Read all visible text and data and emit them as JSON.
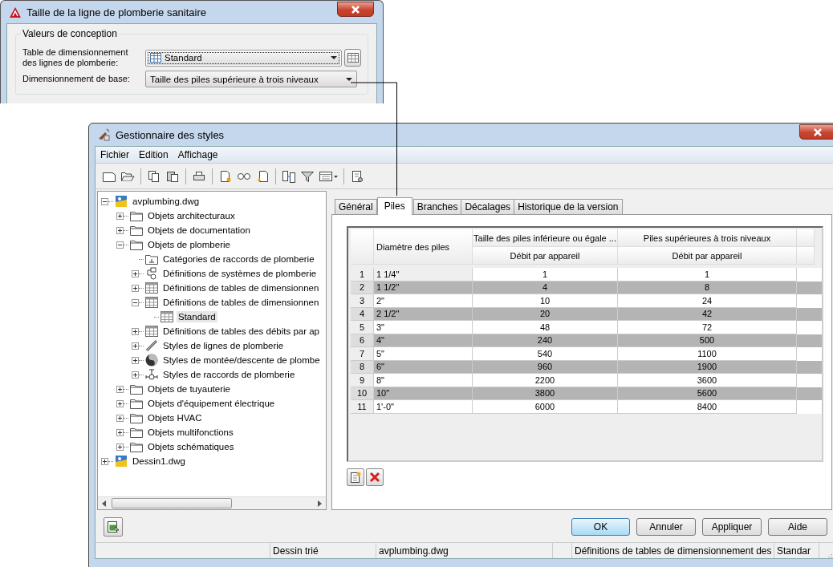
{
  "dialog": {
    "title": "Taille de la ligne de plomberie sanitaire",
    "group": "Valeurs de conception",
    "fields": [
      {
        "label": "Table de dimensionnement des lignes de plomberie:",
        "value": "Standard",
        "focused": true,
        "kind": "table"
      },
      {
        "label": "Dimensionnement de base:",
        "value": "Taille des piles supérieure à trois niveaux",
        "focused": false,
        "kind": "plain"
      }
    ]
  },
  "manager": {
    "title": "Gestionnaire des styles",
    "menu": [
      "Fichier",
      "Edition",
      "Affichage"
    ],
    "tree": [
      {
        "label": "avplumbing.dwg",
        "kind": "drawing",
        "expanded": true,
        "selected": false,
        "children": [
          {
            "label": "Objets architecturaux",
            "kind": "folder",
            "expanded": false,
            "selected": false
          },
          {
            "label": "Objets de documentation",
            "kind": "folder",
            "expanded": false,
            "selected": false
          },
          {
            "label": "Objets de plomberie",
            "kind": "folder",
            "expanded": true,
            "selected": false,
            "children": [
              {
                "label": "Catégories de raccords de plomberie",
                "kind": "category",
                "selected": false
              },
              {
                "label": "Définitions de systèmes de plomberie",
                "kind": "system",
                "expanded": false,
                "selected": false
              },
              {
                "label": "Définitions de tables de dimensionnen",
                "kind": "table",
                "expanded": false,
                "selected": false
              },
              {
                "label": "Définitions de tables de dimensionnen",
                "kind": "table",
                "expanded": true,
                "selected": false,
                "children": [
                  {
                    "label": "Standard",
                    "kind": "table",
                    "selected": true
                  }
                ]
              },
              {
                "label": "Définitions de tables des débits par ap",
                "kind": "table",
                "expanded": false,
                "selected": false
              },
              {
                "label": "Styles de lignes de plomberie",
                "kind": "line",
                "expanded": false,
                "selected": false
              },
              {
                "label": "Styles de montée/descente de plombe",
                "kind": "riser",
                "expanded": false,
                "selected": false
              },
              {
                "label": "Styles de raccords de plomberie",
                "kind": "fitting",
                "expanded": false,
                "selected": false
              }
            ]
          },
          {
            "label": "Objets de tuyauterie",
            "kind": "folder",
            "expanded": false,
            "selected": false
          },
          {
            "label": "Objets d'équipement électrique",
            "kind": "folder",
            "expanded": false,
            "selected": false
          },
          {
            "label": "Objets HVAC",
            "kind": "folder",
            "expanded": false,
            "selected": false
          },
          {
            "label": "Objets multifonctions",
            "kind": "folder",
            "expanded": false,
            "selected": false
          },
          {
            "label": "Objets schématiques",
            "kind": "folder",
            "expanded": false,
            "selected": false
          }
        ]
      },
      {
        "label": "Dessin1.dwg",
        "kind": "drawing",
        "expanded": false,
        "selected": false
      }
    ],
    "tabs": [
      {
        "label": "Général",
        "selected": false
      },
      {
        "label": "Piles",
        "selected": true
      },
      {
        "label": "Branches",
        "selected": false
      },
      {
        "label": "Décalages",
        "selected": false
      },
      {
        "label": "Historique de la version",
        "selected": false
      }
    ],
    "table": {
      "first_column": "Diamètre des piles",
      "groups": [
        {
          "title": "Taille des piles inférieure ou égale ...",
          "sub": "Débit par appareil"
        },
        {
          "title": "Piles supérieures à trois niveaux",
          "sub": "Débit par appareil"
        }
      ],
      "rows": [
        {
          "num": "1",
          "diameter": "1 1/4\"",
          "values": [
            "1",
            "1"
          ]
        },
        {
          "num": "2",
          "diameter": "1 1/2\"",
          "values": [
            "4",
            "8"
          ]
        },
        {
          "num": "3",
          "diameter": "2\"",
          "values": [
            "10",
            "24"
          ]
        },
        {
          "num": "4",
          "diameter": "2 1/2\"",
          "values": [
            "20",
            "42"
          ]
        },
        {
          "num": "5",
          "diameter": "3\"",
          "values": [
            "48",
            "72"
          ]
        },
        {
          "num": "6",
          "diameter": "4\"",
          "values": [
            "240",
            "500"
          ]
        },
        {
          "num": "7",
          "diameter": "5\"",
          "values": [
            "540",
            "1100"
          ]
        },
        {
          "num": "8",
          "diameter": "6\"",
          "values": [
            "960",
            "1900"
          ]
        },
        {
          "num": "9",
          "diameter": "8\"",
          "values": [
            "2200",
            "3600"
          ]
        },
        {
          "num": "10",
          "diameter": "10\"",
          "values": [
            "3800",
            "5600"
          ]
        },
        {
          "num": "11",
          "diameter": "1'-0\"",
          "values": [
            "6000",
            "8400"
          ]
        }
      ]
    },
    "buttons": [
      {
        "label": "OK",
        "default": true
      },
      {
        "label": "Annuler",
        "default": false
      },
      {
        "label": "Appliquer",
        "default": false
      },
      {
        "label": "Aide",
        "default": false
      }
    ],
    "status_bar": [
      "Dessin trié",
      "avplumbing.dwg",
      "Définitions de tables de dimensionnement des",
      "Standar"
    ]
  }
}
